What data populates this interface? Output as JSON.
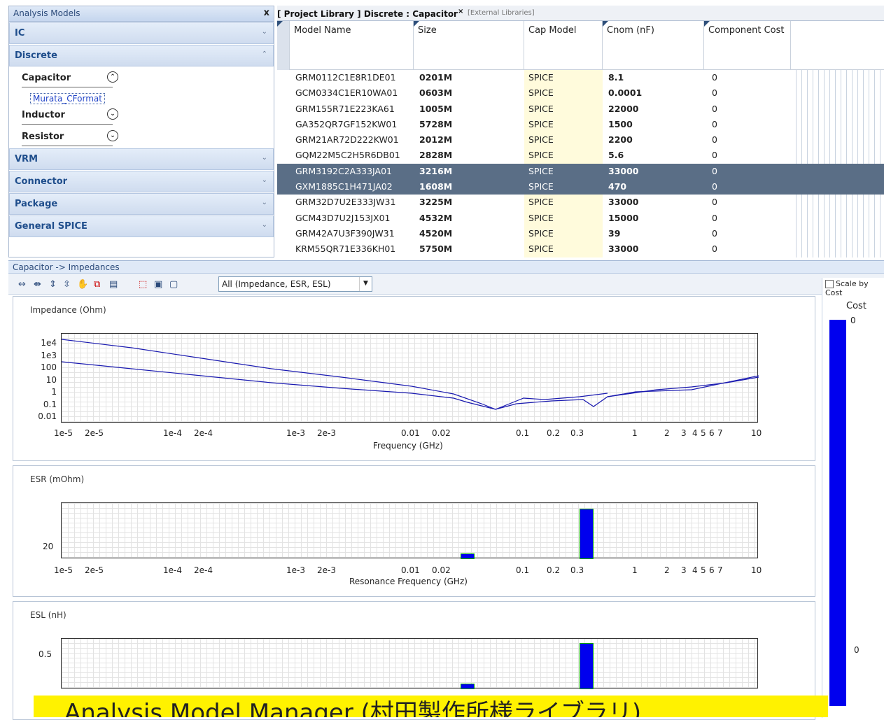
{
  "left_panel": {
    "title": "Analysis Models",
    "close": "x",
    "groups": [
      "IC",
      "Discrete"
    ],
    "subs": [
      {
        "label": "Capacitor",
        "icon": "^"
      },
      {
        "label": "Inductor",
        "icon": "v"
      },
      {
        "label": "Resistor",
        "icon": "v"
      }
    ],
    "file": "Murata_CFormat",
    "groups2": [
      "VRM",
      "Connector",
      "Package",
      "General SPICE"
    ]
  },
  "tabs": {
    "active": "[ Project Library ] Discrete : Capacitor",
    "close": "×",
    "other": "[External Libraries]"
  },
  "columns": [
    "Model Name",
    "Size",
    "Cap Model",
    "Cnom (nF)",
    "Component Cost"
  ],
  "rows": [
    [
      "GRM0112C1E8R1DE01",
      "0201M",
      "SPICE",
      "8.1",
      "0"
    ],
    [
      "GCM0334C1ER10WA01",
      "0603M",
      "SPICE",
      "0.0001",
      "0"
    ],
    [
      "GRM155R71E223KA61",
      "1005M",
      "SPICE",
      "22000",
      "0"
    ],
    [
      "GA352QR7GF152KW01",
      "5728M",
      "SPICE",
      "1500",
      "0"
    ],
    [
      "GRM21AR72D222KW01",
      "2012M",
      "SPICE",
      "2200",
      "0"
    ],
    [
      "GQM22M5C2H5R6DB01",
      "2828M",
      "SPICE",
      "5.6",
      "0"
    ],
    [
      "GRM3192C2A333JA01",
      "3216M",
      "SPICE",
      "33000",
      "0"
    ],
    [
      "GXM1885C1H471JA02",
      "1608M",
      "SPICE",
      "470",
      "0"
    ],
    [
      "GRM32D7U2E333JW31",
      "3225M",
      "SPICE",
      "33000",
      "0"
    ],
    [
      "GCM43D7U2J153JX01",
      "4532M",
      "SPICE",
      "15000",
      "0"
    ],
    [
      "GRM42A7U3F390JW31",
      "4520M",
      "SPICE",
      "39",
      "0"
    ],
    [
      "KRM55QR71E336KH01",
      "5750M",
      "SPICE",
      "33000",
      "0"
    ]
  ],
  "bottom": {
    "title": "Capacitor -> Impedances",
    "dropdown": "All (Impedance, ESR, ESL)",
    "scale_by_cost": "Scale by Cost",
    "cost_label": "Cost",
    "cost_top": "0",
    "cost_bottom": "0"
  },
  "plots": {
    "impedance": {
      "label": "Impedance (Ohm)",
      "xlabel": "Frequency (GHz)",
      "yticks": [
        "1e4",
        "1e3",
        "100",
        "10",
        "1",
        "0.1",
        "0.01"
      ]
    },
    "esr": {
      "label": "ESR (mOhm)",
      "xlabel": "Resonance Frequency (GHz)",
      "yticks": [
        "20"
      ]
    },
    "esl": {
      "label": "ESL (nH)",
      "yticks": [
        "0.5"
      ]
    },
    "xticks": [
      "1e-5",
      "2e-5",
      "1e-4",
      "2e-4",
      "1e-3",
      "2e-3",
      "0.01",
      "0.02",
      "0.1",
      "0.2",
      "0.3",
      "1",
      "2",
      "3",
      "4",
      "5",
      "6",
      "7",
      "10"
    ]
  },
  "banner": "Analysis Model Manager (村田製作所様ライブラリ)"
}
